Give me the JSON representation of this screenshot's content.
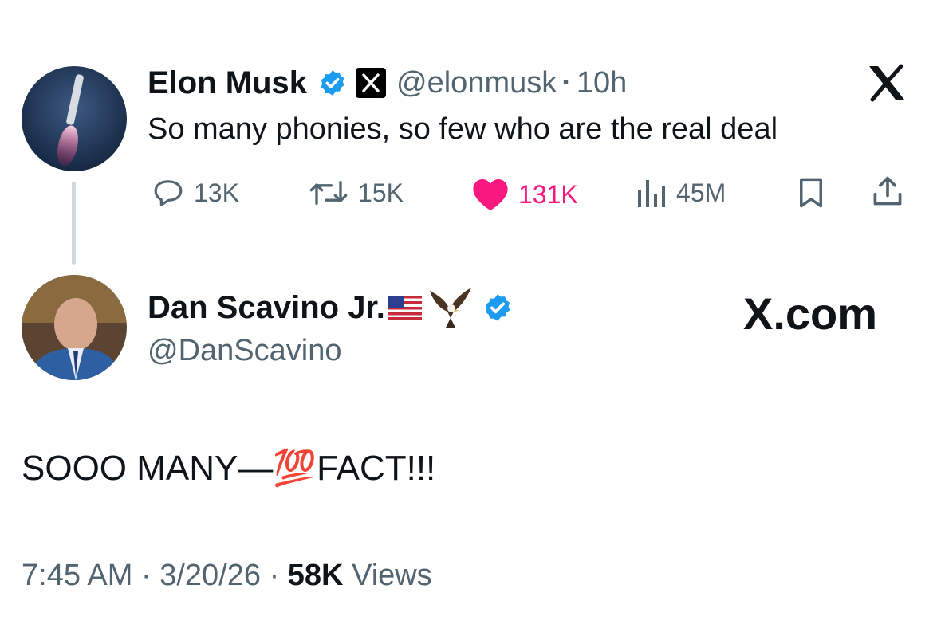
{
  "parent_tweet": {
    "author_name": "Elon Musk",
    "handle": "@elonmusk",
    "separator": "·",
    "time": "10h",
    "text": "So many phonies, so few who are the real deal",
    "stats": {
      "replies": "13K",
      "reposts": "15K",
      "likes": "131K",
      "views": "45M"
    },
    "colors": {
      "like": "#f91880",
      "verified": "#1d9bf0",
      "muted": "#536471"
    }
  },
  "quote_tweet": {
    "author_name": "Dan Scavino Jr.",
    "handle": "@DanScavino",
    "brand": "X.com",
    "text": "SOOO MANY—💯FACT!!!",
    "footer": {
      "time": "7:45 AM",
      "sep1": "·",
      "date": "3/20/26",
      "sep2": "·",
      "views_count": "58K",
      "views_label": "Views"
    }
  }
}
